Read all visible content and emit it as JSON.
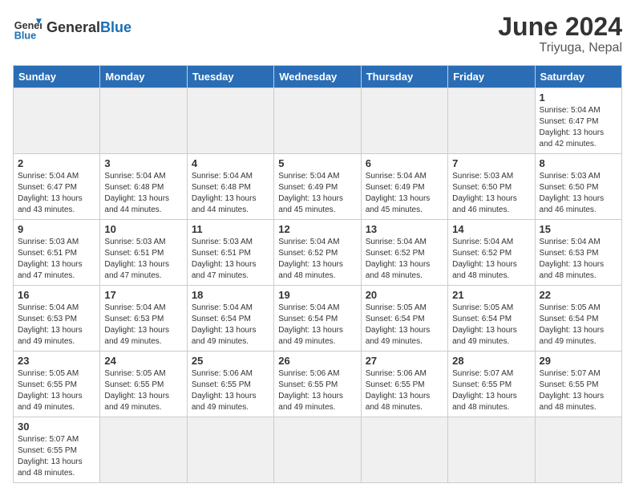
{
  "header": {
    "logo_general": "General",
    "logo_blue": "Blue",
    "month_year": "June 2024",
    "location": "Triyuga, Nepal"
  },
  "weekdays": [
    "Sunday",
    "Monday",
    "Tuesday",
    "Wednesday",
    "Thursday",
    "Friday",
    "Saturday"
  ],
  "weeks": [
    [
      {
        "day": "",
        "info": ""
      },
      {
        "day": "",
        "info": ""
      },
      {
        "day": "",
        "info": ""
      },
      {
        "day": "",
        "info": ""
      },
      {
        "day": "",
        "info": ""
      },
      {
        "day": "",
        "info": ""
      },
      {
        "day": "1",
        "info": "Sunrise: 5:04 AM\nSunset: 6:47 PM\nDaylight: 13 hours\nand 42 minutes."
      }
    ],
    [
      {
        "day": "2",
        "info": "Sunrise: 5:04 AM\nSunset: 6:47 PM\nDaylight: 13 hours\nand 43 minutes."
      },
      {
        "day": "3",
        "info": "Sunrise: 5:04 AM\nSunset: 6:48 PM\nDaylight: 13 hours\nand 44 minutes."
      },
      {
        "day": "4",
        "info": "Sunrise: 5:04 AM\nSunset: 6:48 PM\nDaylight: 13 hours\nand 44 minutes."
      },
      {
        "day": "5",
        "info": "Sunrise: 5:04 AM\nSunset: 6:49 PM\nDaylight: 13 hours\nand 45 minutes."
      },
      {
        "day": "6",
        "info": "Sunrise: 5:04 AM\nSunset: 6:49 PM\nDaylight: 13 hours\nand 45 minutes."
      },
      {
        "day": "7",
        "info": "Sunrise: 5:03 AM\nSunset: 6:50 PM\nDaylight: 13 hours\nand 46 minutes."
      },
      {
        "day": "8",
        "info": "Sunrise: 5:03 AM\nSunset: 6:50 PM\nDaylight: 13 hours\nand 46 minutes."
      }
    ],
    [
      {
        "day": "9",
        "info": "Sunrise: 5:03 AM\nSunset: 6:51 PM\nDaylight: 13 hours\nand 47 minutes."
      },
      {
        "day": "10",
        "info": "Sunrise: 5:03 AM\nSunset: 6:51 PM\nDaylight: 13 hours\nand 47 minutes."
      },
      {
        "day": "11",
        "info": "Sunrise: 5:03 AM\nSunset: 6:51 PM\nDaylight: 13 hours\nand 47 minutes."
      },
      {
        "day": "12",
        "info": "Sunrise: 5:04 AM\nSunset: 6:52 PM\nDaylight: 13 hours\nand 48 minutes."
      },
      {
        "day": "13",
        "info": "Sunrise: 5:04 AM\nSunset: 6:52 PM\nDaylight: 13 hours\nand 48 minutes."
      },
      {
        "day": "14",
        "info": "Sunrise: 5:04 AM\nSunset: 6:52 PM\nDaylight: 13 hours\nand 48 minutes."
      },
      {
        "day": "15",
        "info": "Sunrise: 5:04 AM\nSunset: 6:53 PM\nDaylight: 13 hours\nand 48 minutes."
      }
    ],
    [
      {
        "day": "16",
        "info": "Sunrise: 5:04 AM\nSunset: 6:53 PM\nDaylight: 13 hours\nand 49 minutes."
      },
      {
        "day": "17",
        "info": "Sunrise: 5:04 AM\nSunset: 6:53 PM\nDaylight: 13 hours\nand 49 minutes."
      },
      {
        "day": "18",
        "info": "Sunrise: 5:04 AM\nSunset: 6:54 PM\nDaylight: 13 hours\nand 49 minutes."
      },
      {
        "day": "19",
        "info": "Sunrise: 5:04 AM\nSunset: 6:54 PM\nDaylight: 13 hours\nand 49 minutes."
      },
      {
        "day": "20",
        "info": "Sunrise: 5:05 AM\nSunset: 6:54 PM\nDaylight: 13 hours\nand 49 minutes."
      },
      {
        "day": "21",
        "info": "Sunrise: 5:05 AM\nSunset: 6:54 PM\nDaylight: 13 hours\nand 49 minutes."
      },
      {
        "day": "22",
        "info": "Sunrise: 5:05 AM\nSunset: 6:54 PM\nDaylight: 13 hours\nand 49 minutes."
      }
    ],
    [
      {
        "day": "23",
        "info": "Sunrise: 5:05 AM\nSunset: 6:55 PM\nDaylight: 13 hours\nand 49 minutes."
      },
      {
        "day": "24",
        "info": "Sunrise: 5:05 AM\nSunset: 6:55 PM\nDaylight: 13 hours\nand 49 minutes."
      },
      {
        "day": "25",
        "info": "Sunrise: 5:06 AM\nSunset: 6:55 PM\nDaylight: 13 hours\nand 49 minutes."
      },
      {
        "day": "26",
        "info": "Sunrise: 5:06 AM\nSunset: 6:55 PM\nDaylight: 13 hours\nand 49 minutes."
      },
      {
        "day": "27",
        "info": "Sunrise: 5:06 AM\nSunset: 6:55 PM\nDaylight: 13 hours\nand 48 minutes."
      },
      {
        "day": "28",
        "info": "Sunrise: 5:07 AM\nSunset: 6:55 PM\nDaylight: 13 hours\nand 48 minutes."
      },
      {
        "day": "29",
        "info": "Sunrise: 5:07 AM\nSunset: 6:55 PM\nDaylight: 13 hours\nand 48 minutes."
      }
    ],
    [
      {
        "day": "30",
        "info": "Sunrise: 5:07 AM\nSunset: 6:55 PM\nDaylight: 13 hours\nand 48 minutes."
      },
      {
        "day": "",
        "info": ""
      },
      {
        "day": "",
        "info": ""
      },
      {
        "day": "",
        "info": ""
      },
      {
        "day": "",
        "info": ""
      },
      {
        "day": "",
        "info": ""
      },
      {
        "day": "",
        "info": ""
      }
    ]
  ]
}
